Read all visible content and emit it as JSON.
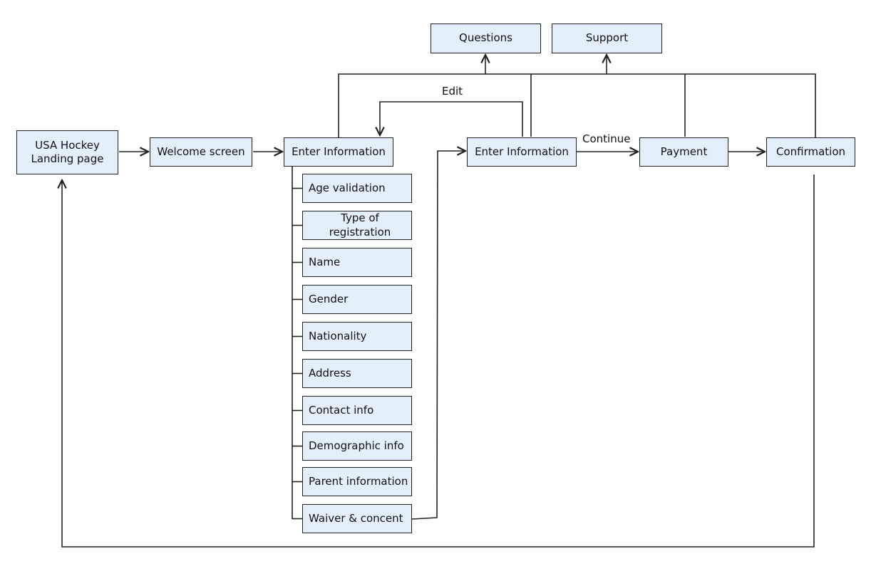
{
  "nodes": {
    "landing": "USA Hockey\nLanding page",
    "landing_line1": "USA Hockey",
    "landing_line2": "Landing page",
    "welcome": "Welcome screen",
    "enter_info_1": "Enter Information",
    "enter_info_2": "Enter Information",
    "payment": "Payment",
    "confirmation": "Confirmation",
    "questions": "Questions",
    "support": "Support"
  },
  "sub_items": [
    "Age validation",
    "Type of registration",
    "Name",
    "Gender",
    "Nationality",
    "Address",
    "Contact info",
    "Demographic info",
    "Parent information",
    "Waiver & concent"
  ],
  "edge_labels": {
    "edit": "Edit",
    "continue": "Continue"
  },
  "colors": {
    "box_fill": "#e3f0fc",
    "stroke": "#222222"
  }
}
